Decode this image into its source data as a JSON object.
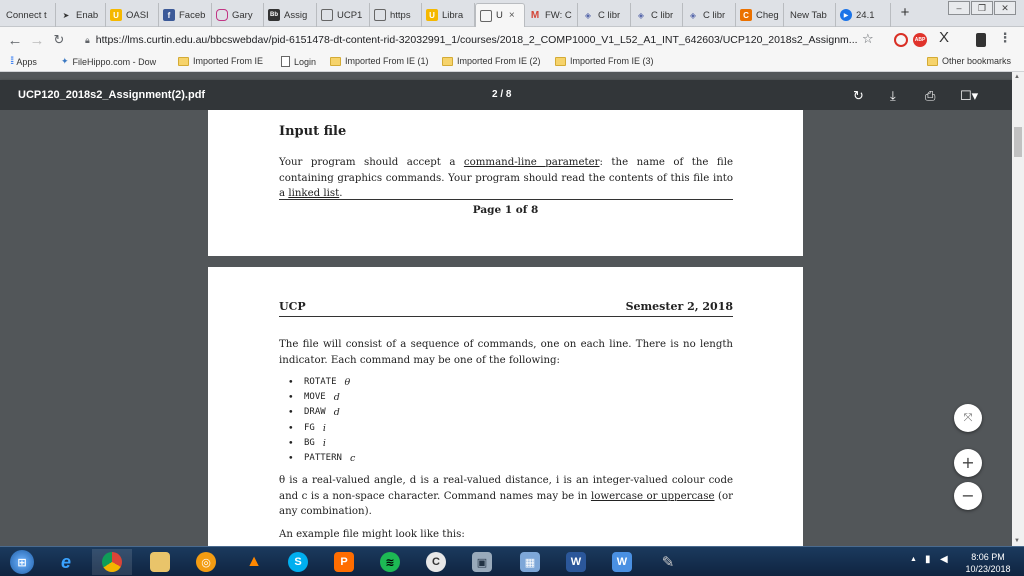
{
  "tabs": [
    {
      "label": "Connect t",
      "icon": "none"
    },
    {
      "label": "Enab",
      "icon": "arrow-icon"
    },
    {
      "label": "OASI",
      "icon": "oasis-icon"
    },
    {
      "label": "Faceb",
      "icon": "facebook-icon"
    },
    {
      "label": "Gary",
      "icon": "instagram-icon"
    },
    {
      "label": "Assig",
      "icon": "bb-icon"
    },
    {
      "label": "UCP1",
      "icon": "doc-icon"
    },
    {
      "label": "https",
      "icon": "doc-icon"
    },
    {
      "label": "Libra",
      "icon": "library-icon"
    },
    {
      "label": "U",
      "icon": "doc-icon"
    },
    {
      "label": "FW: C",
      "icon": "gmail-icon"
    },
    {
      "label": "C libr",
      "icon": "cplusplus-icon"
    },
    {
      "label": "C libr",
      "icon": "cplusplus-icon"
    },
    {
      "label": "C libr",
      "icon": "cplusplus-icon"
    },
    {
      "label": "Cheg",
      "icon": "chegg-icon"
    },
    {
      "label": "New Tab",
      "icon": "none"
    },
    {
      "label": "24.1",
      "icon": "play-icon"
    }
  ],
  "tab_close": "×",
  "new_tab": "+",
  "toolbar": {
    "url": "https://lms.curtin.edu.au/bbcswebdav/pid-6151478-dt-content-rid-32032991_1/courses/2018_2_COMP1000_V1_L52_A1_INT_642603/UCP120_2018s2_Assignm...",
    "ext_abp": "ABP",
    "ext_x": "X"
  },
  "bookmarks": [
    {
      "label": "Apps",
      "type": "apps"
    },
    {
      "label": "FileHippo.com - Dow",
      "type": "site"
    },
    {
      "label": "Imported From IE",
      "type": "folder"
    },
    {
      "label": "Login",
      "type": "doc"
    },
    {
      "label": "Imported From IE (1)",
      "type": "folder"
    },
    {
      "label": "Imported From IE (2)",
      "type": "folder"
    },
    {
      "label": "Imported From IE (3)",
      "type": "folder"
    }
  ],
  "other_bookmarks": "Other bookmarks",
  "pdf": {
    "filename": "UCP120_2018s2_Assignment(2).pdf",
    "page_indicator": "2 / 8"
  },
  "page1": {
    "section_title": "Input file",
    "para_a": "Your program should accept a ",
    "link1": "command-line parameter",
    "para_b": ": the name of the file containing graphics commands. Your program should read the contents of this file into a ",
    "link2": "linked list",
    "para_c": ".",
    "footer": "Page 1 of 8"
  },
  "page2": {
    "header_left": "UCP",
    "header_right": "Semester 2, 2018",
    "intro": "The file will consist of a sequence of commands, one on each line. There is no length indicator. Each command may be one of the following:",
    "commands": [
      {
        "keyword": "ROTATE",
        "arg": "θ"
      },
      {
        "keyword": "MOVE",
        "arg": "d"
      },
      {
        "keyword": "DRAW",
        "arg": "d"
      },
      {
        "keyword": "FG",
        "arg": "i"
      },
      {
        "keyword": "BG",
        "arg": "i"
      },
      {
        "keyword": "PATTERN",
        "arg": "c"
      }
    ],
    "desc_a": "θ is a real-valued angle, d is a real-valued distance, i is an integer-valued colour code and c is a non-space character. Command names may be in ",
    "desc_link": "lowercase or uppercase",
    "desc_b": " (or any combination).",
    "example": "An example file might look like this:"
  },
  "zoom": {
    "fit": "⤧",
    "plus": "+",
    "minus": "−"
  },
  "taskbar": {
    "time": "8:06 PM",
    "date": "10/23/2018"
  }
}
